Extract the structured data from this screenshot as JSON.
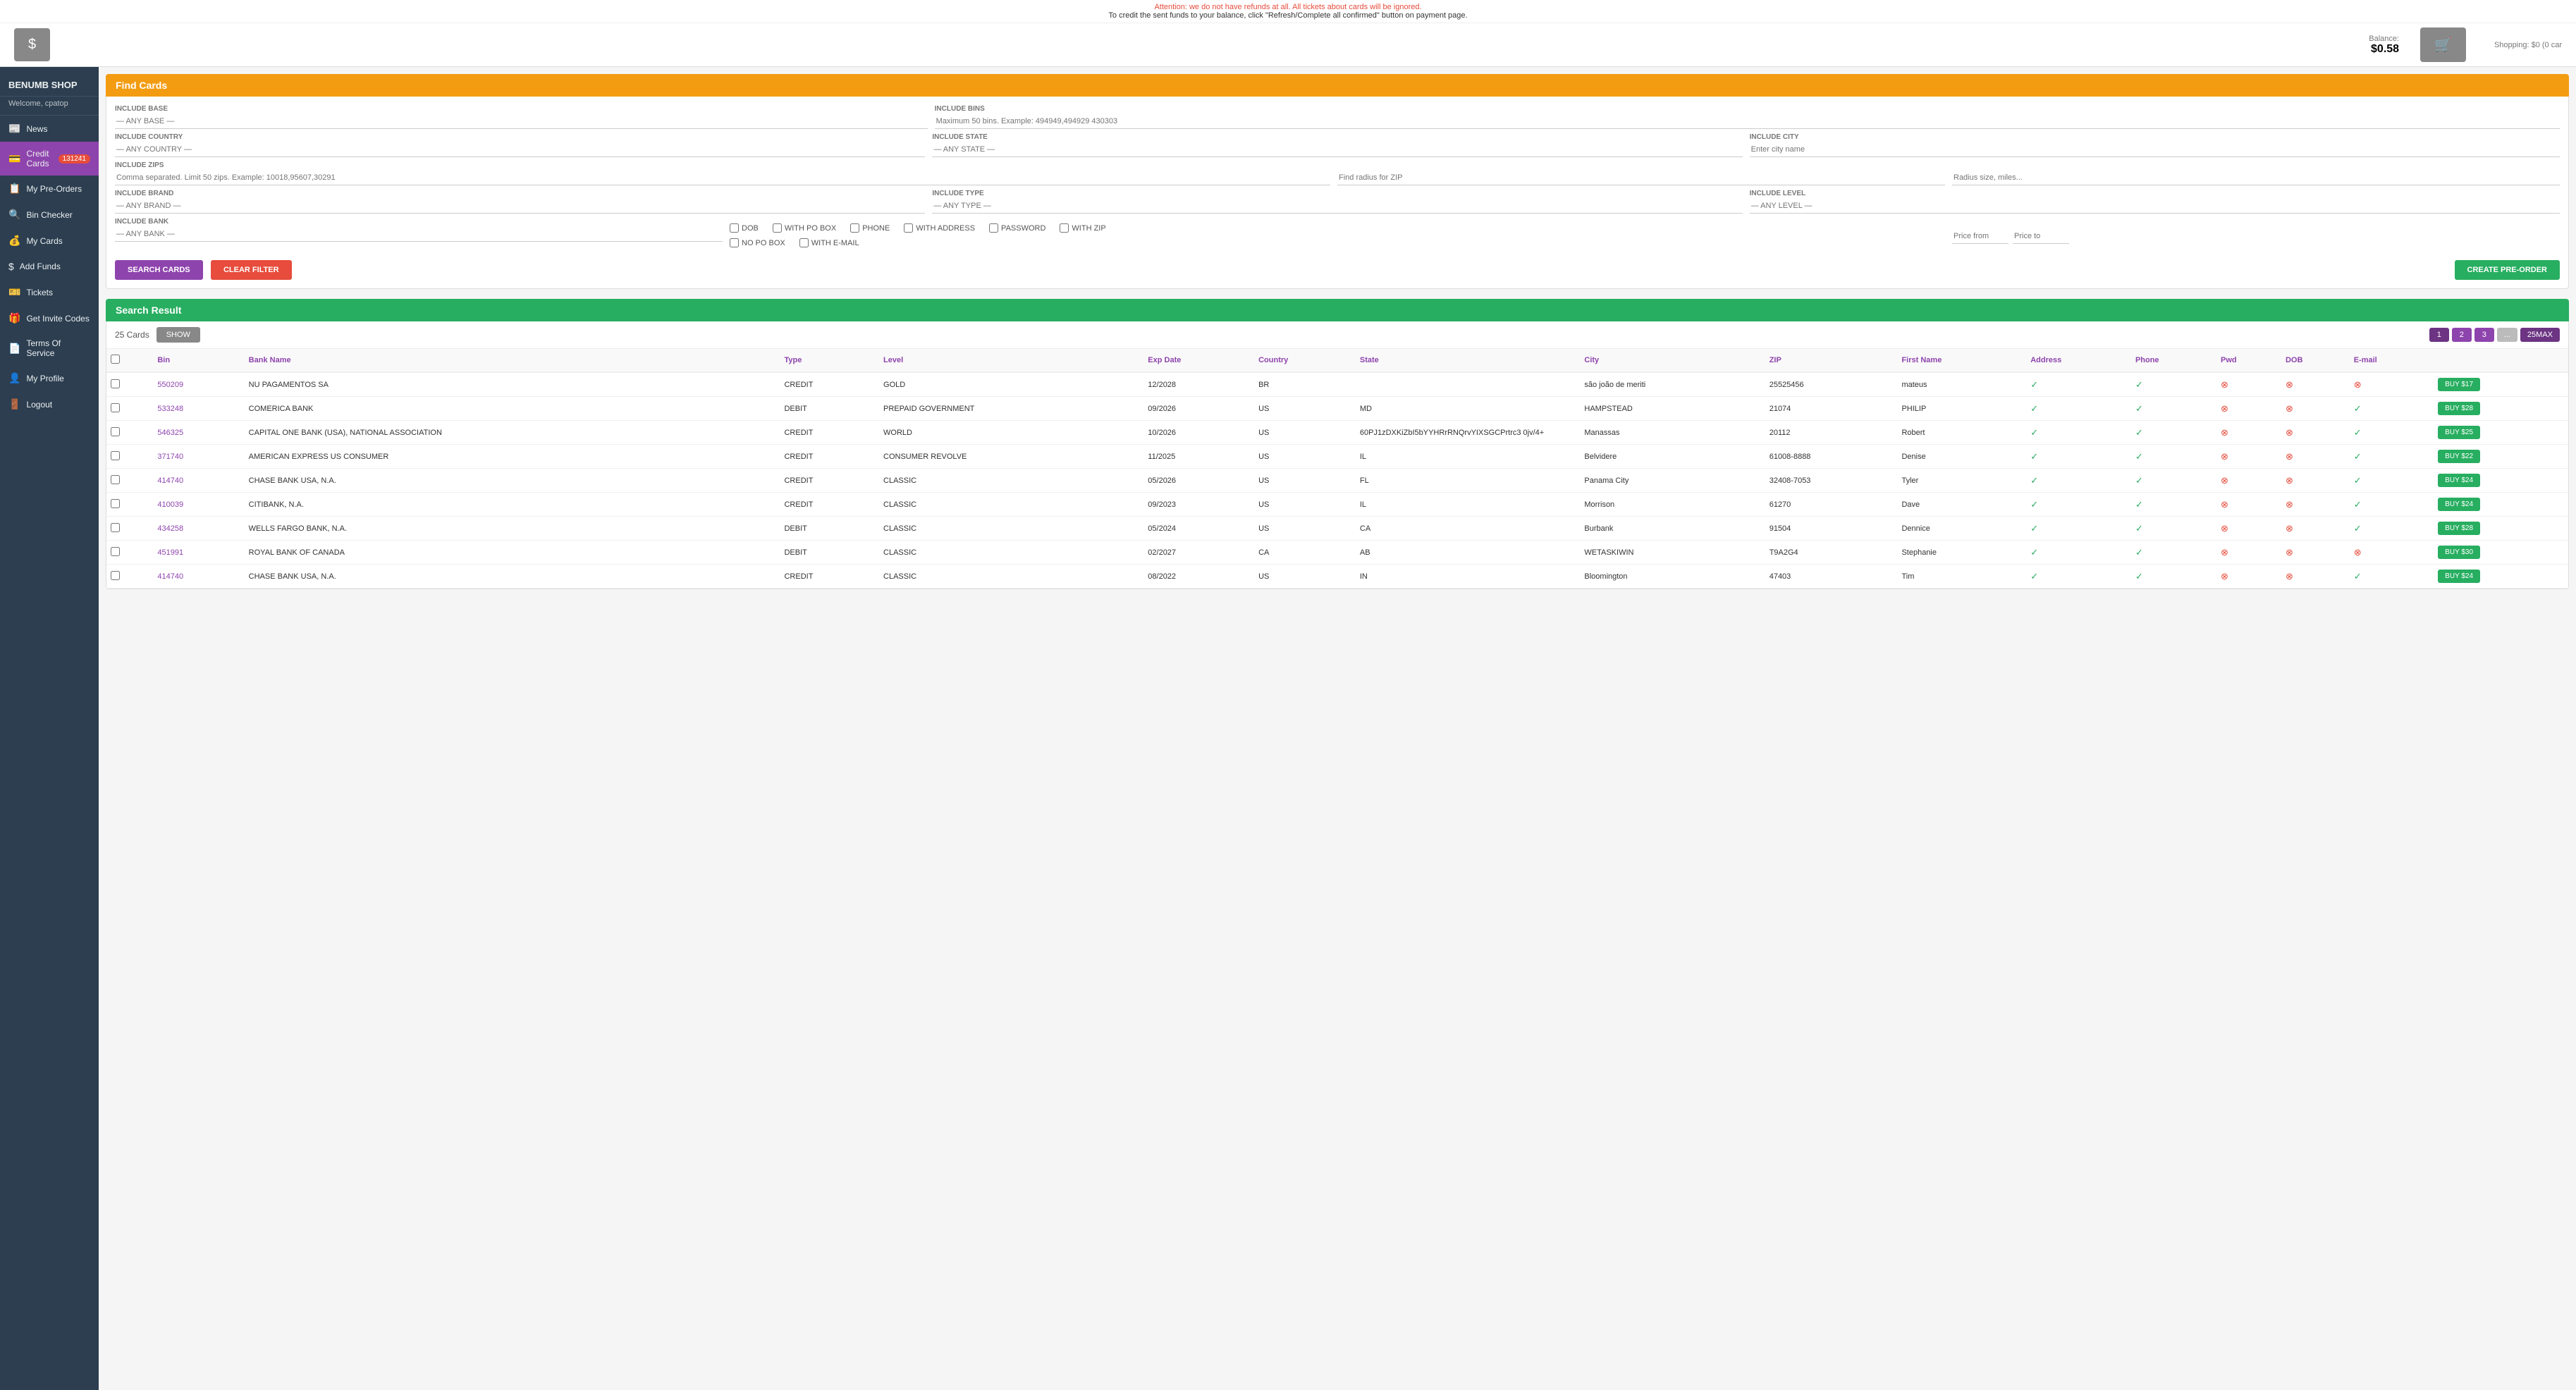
{
  "alerts": {
    "red": "Attention: we do not have refunds at all. All tickets about cards will be ignored.",
    "black": "To credit the sent funds to your balance, click \"Refresh/Complete all confirmed\" button on payment page."
  },
  "header": {
    "balance_label": "Balance:",
    "balance_value": "$0.58",
    "shopping_label": "Shopping:",
    "shopping_value": "$0 (0 car"
  },
  "sidebar": {
    "brand": "BENUMB SHOP",
    "welcome": "Welcome, cpatop",
    "items": [
      {
        "id": "news",
        "label": "News",
        "icon": "📰",
        "active": false
      },
      {
        "id": "credit-cards",
        "label": "Credit Cards",
        "badge": "131241",
        "icon": "💳",
        "active": true
      },
      {
        "id": "my-pre-orders",
        "label": "My Pre-Orders",
        "icon": "📋",
        "active": false
      },
      {
        "id": "bin-checker",
        "label": "Bin Checker",
        "icon": "🔍",
        "active": false
      },
      {
        "id": "my-cards",
        "label": "My Cards",
        "icon": "💰",
        "active": false
      },
      {
        "id": "add-funds",
        "label": "Add Funds",
        "icon": "$",
        "active": false
      },
      {
        "id": "tickets",
        "label": "Tickets",
        "icon": "🎫",
        "active": false
      },
      {
        "id": "get-invite-codes",
        "label": "Get Invite Codes",
        "icon": "🎁",
        "active": false
      },
      {
        "id": "terms",
        "label": "Terms Of Service",
        "icon": "📄",
        "active": false
      },
      {
        "id": "my-profile",
        "label": "My Profile",
        "icon": "👤",
        "active": false
      },
      {
        "id": "logout",
        "label": "Logout",
        "icon": "🚪",
        "active": false
      }
    ]
  },
  "find_cards": {
    "title": "Find Cards",
    "filters": {
      "include_base_label": "INCLUDE BASE",
      "include_base_placeholder": "— ANY BASE —",
      "include_bins_label": "INCLUDE BINS",
      "include_bins_placeholder": "Maximum 50 bins. Example: 494949,494929 430303",
      "include_country_label": "INCLUDE COUNTRY",
      "include_country_placeholder": "— ANY COUNTRY —",
      "include_state_label": "INCLUDE STATE",
      "include_state_placeholder": "— ANY STATE —",
      "include_city_label": "INCLUDE CITY",
      "include_city_placeholder": "Enter city name",
      "include_zips_label": "INCLUDE ZIPS",
      "include_zips_placeholder": "Comma separated. Limit 50 zips. Example: 10018,95607,30291",
      "zip_radius_placeholder": "Find radius for ZIP",
      "zip_radius_size_placeholder": "Radius size, miles...",
      "include_brand_label": "INCLUDE BRAND",
      "include_brand_placeholder": "— ANY BRAND —",
      "include_type_label": "INCLUDE TYPE",
      "include_type_placeholder": "— ANY TYPE —",
      "include_level_label": "INCLUDE LEVEL",
      "include_level_placeholder": "— ANY LEVEL —",
      "include_bank_label": "INCLUDE BANK",
      "include_bank_placeholder": "— ANY BANK —",
      "price_from_placeholder": "Price from",
      "price_to_placeholder": "Price to"
    },
    "checkboxes": [
      {
        "id": "dob",
        "label": "DOB"
      },
      {
        "id": "with_po_box",
        "label": "WITH PO BOX"
      },
      {
        "id": "phone",
        "label": "PHONE"
      },
      {
        "id": "with_address",
        "label": "WITH ADDRESS"
      },
      {
        "id": "password",
        "label": "PASSWORD"
      },
      {
        "id": "with_zip",
        "label": "WITH ZIP"
      },
      {
        "id": "no_po_box",
        "label": "NO PO BOX"
      },
      {
        "id": "with_email",
        "label": "WITH E-MAIL"
      }
    ],
    "buttons": {
      "search": "SEARCH CARDS",
      "clear": "CLEAR FILTER",
      "create_preorder": "CREATE PRE-ORDER"
    }
  },
  "search_result": {
    "title": "Search Result",
    "count_label": "25 Cards",
    "show_btn": "SHOW",
    "pagination": {
      "pages": [
        "1",
        "2",
        "3",
        "..."
      ],
      "max_btn": "25MAX"
    },
    "columns": [
      "",
      "Bin",
      "Bank Name",
      "Type",
      "Level",
      "Exp Date",
      "Country",
      "State",
      "City",
      "ZIP",
      "First Name",
      "Address",
      "Phone",
      "Pwd",
      "DOB",
      "E-mail",
      ""
    ],
    "rows": [
      {
        "bin": "550209",
        "bank": "NU PAGAMENTOS SA",
        "type": "CREDIT",
        "level": "GOLD",
        "exp": "12/2028",
        "country": "BR",
        "state": "",
        "city": "são joão de meriti",
        "zip": "25525456",
        "fname": "mateus",
        "address": true,
        "phone": true,
        "pwd": "circle",
        "dob": "circle",
        "email": "circle",
        "has_email": false,
        "price": "$17"
      },
      {
        "bin": "533248",
        "bank": "COMERICA BANK",
        "type": "DEBIT",
        "level": "PREPAID GOVERNMENT",
        "exp": "09/2026",
        "country": "US",
        "state": "MD",
        "city": "HAMPSTEAD",
        "zip": "21074",
        "fname": "PHILIP",
        "address": true,
        "phone": true,
        "pwd": "circle",
        "dob": "circle",
        "email": "circle",
        "has_email": true,
        "price": "$28"
      },
      {
        "bin": "546325",
        "bank": "CAPITAL ONE BANK (USA), NATIONAL ASSOCIATION",
        "type": "CREDIT",
        "level": "WORLD",
        "exp": "10/2026",
        "country": "US",
        "state": "60PJ1zDXKiZbI5bYYHRrRNQrvYIXSGCPrtrc3 0jv/4+",
        "city": "Manassas",
        "zip": "20112",
        "fname": "Robert",
        "address": true,
        "phone": true,
        "pwd": "circle",
        "dob": "circle",
        "email": "circle",
        "has_email": true,
        "price": "$25"
      },
      {
        "bin": "371740",
        "bank": "AMERICAN EXPRESS US CONSUMER",
        "type": "CREDIT",
        "level": "CONSUMER REVOLVE",
        "exp": "11/2025",
        "country": "US",
        "state": "IL",
        "city": "Belvidere",
        "zip": "61008-8888",
        "fname": "Denise",
        "address": true,
        "phone": true,
        "pwd": "circle",
        "dob": "circle",
        "email": "circle",
        "has_email": true,
        "price": "$22"
      },
      {
        "bin": "414740",
        "bank": "CHASE BANK USA, N.A.",
        "type": "CREDIT",
        "level": "CLASSIC",
        "exp": "05/2026",
        "country": "US",
        "state": "FL",
        "city": "Panama City",
        "zip": "32408-7053",
        "fname": "Tyler",
        "address": true,
        "phone": true,
        "pwd": "circle",
        "dob": "circle",
        "email": "circle",
        "has_email": true,
        "price": "$24"
      },
      {
        "bin": "410039",
        "bank": "CITIBANK, N.A.",
        "type": "CREDIT",
        "level": "CLASSIC",
        "exp": "09/2023",
        "country": "US",
        "state": "IL",
        "city": "Morrison",
        "zip": "61270",
        "fname": "Dave",
        "address": true,
        "phone": true,
        "pwd": "circle",
        "dob": "circle",
        "email": "circle",
        "has_email": true,
        "price": "$24"
      },
      {
        "bin": "434258",
        "bank": "WELLS FARGO BANK, N.A.",
        "type": "DEBIT",
        "level": "CLASSIC",
        "exp": "05/2024",
        "country": "US",
        "state": "CA",
        "city": "Burbank",
        "zip": "91504",
        "fname": "Dennice",
        "address": true,
        "phone": true,
        "pwd": "circle",
        "dob": "circle",
        "email": "circle",
        "has_email": true,
        "price": "$28"
      },
      {
        "bin": "451991",
        "bank": "ROYAL BANK OF CANADA",
        "type": "DEBIT",
        "level": "CLASSIC",
        "exp": "02/2027",
        "country": "CA",
        "state": "AB",
        "city": "WETASKIWIN",
        "zip": "T9A2G4",
        "fname": "Stephanie",
        "address": true,
        "phone": true,
        "pwd": "circle",
        "dob": "circle",
        "email": "circle",
        "has_email": false,
        "price": "$30"
      },
      {
        "bin": "414740",
        "bank": "CHASE BANK USA, N.A.",
        "type": "CREDIT",
        "level": "CLASSIC",
        "exp": "08/2022",
        "country": "US",
        "state": "IN",
        "city": "Bloomington",
        "zip": "47403",
        "fname": "Tim",
        "address": true,
        "phone": true,
        "pwd": "circle",
        "dob": "circle",
        "email": "circle",
        "has_email": true,
        "price": "$24"
      }
    ]
  }
}
